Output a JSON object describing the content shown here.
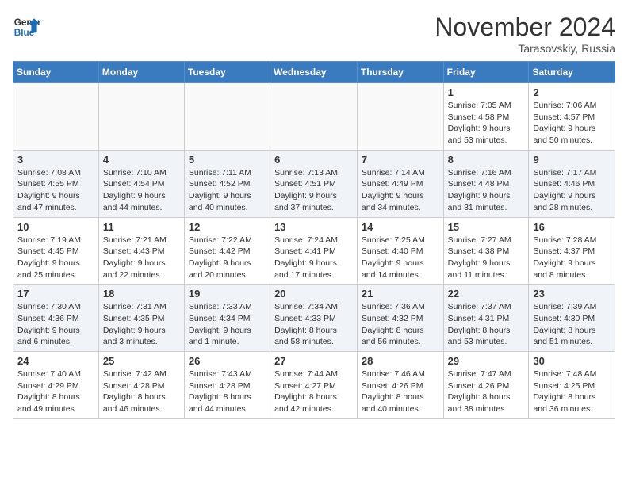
{
  "header": {
    "logo_line1": "General",
    "logo_line2": "Blue",
    "month": "November 2024",
    "location": "Tarasovskiy, Russia"
  },
  "weekdays": [
    "Sunday",
    "Monday",
    "Tuesday",
    "Wednesday",
    "Thursday",
    "Friday",
    "Saturday"
  ],
  "weeks": [
    [
      {
        "day": "",
        "info": ""
      },
      {
        "day": "",
        "info": ""
      },
      {
        "day": "",
        "info": ""
      },
      {
        "day": "",
        "info": ""
      },
      {
        "day": "",
        "info": ""
      },
      {
        "day": "1",
        "info": "Sunrise: 7:05 AM\nSunset: 4:58 PM\nDaylight: 9 hours and 53 minutes."
      },
      {
        "day": "2",
        "info": "Sunrise: 7:06 AM\nSunset: 4:57 PM\nDaylight: 9 hours and 50 minutes."
      }
    ],
    [
      {
        "day": "3",
        "info": "Sunrise: 7:08 AM\nSunset: 4:55 PM\nDaylight: 9 hours and 47 minutes."
      },
      {
        "day": "4",
        "info": "Sunrise: 7:10 AM\nSunset: 4:54 PM\nDaylight: 9 hours and 44 minutes."
      },
      {
        "day": "5",
        "info": "Sunrise: 7:11 AM\nSunset: 4:52 PM\nDaylight: 9 hours and 40 minutes."
      },
      {
        "day": "6",
        "info": "Sunrise: 7:13 AM\nSunset: 4:51 PM\nDaylight: 9 hours and 37 minutes."
      },
      {
        "day": "7",
        "info": "Sunrise: 7:14 AM\nSunset: 4:49 PM\nDaylight: 9 hours and 34 minutes."
      },
      {
        "day": "8",
        "info": "Sunrise: 7:16 AM\nSunset: 4:48 PM\nDaylight: 9 hours and 31 minutes."
      },
      {
        "day": "9",
        "info": "Sunrise: 7:17 AM\nSunset: 4:46 PM\nDaylight: 9 hours and 28 minutes."
      }
    ],
    [
      {
        "day": "10",
        "info": "Sunrise: 7:19 AM\nSunset: 4:45 PM\nDaylight: 9 hours and 25 minutes."
      },
      {
        "day": "11",
        "info": "Sunrise: 7:21 AM\nSunset: 4:43 PM\nDaylight: 9 hours and 22 minutes."
      },
      {
        "day": "12",
        "info": "Sunrise: 7:22 AM\nSunset: 4:42 PM\nDaylight: 9 hours and 20 minutes."
      },
      {
        "day": "13",
        "info": "Sunrise: 7:24 AM\nSunset: 4:41 PM\nDaylight: 9 hours and 17 minutes."
      },
      {
        "day": "14",
        "info": "Sunrise: 7:25 AM\nSunset: 4:40 PM\nDaylight: 9 hours and 14 minutes."
      },
      {
        "day": "15",
        "info": "Sunrise: 7:27 AM\nSunset: 4:38 PM\nDaylight: 9 hours and 11 minutes."
      },
      {
        "day": "16",
        "info": "Sunrise: 7:28 AM\nSunset: 4:37 PM\nDaylight: 9 hours and 8 minutes."
      }
    ],
    [
      {
        "day": "17",
        "info": "Sunrise: 7:30 AM\nSunset: 4:36 PM\nDaylight: 9 hours and 6 minutes."
      },
      {
        "day": "18",
        "info": "Sunrise: 7:31 AM\nSunset: 4:35 PM\nDaylight: 9 hours and 3 minutes."
      },
      {
        "day": "19",
        "info": "Sunrise: 7:33 AM\nSunset: 4:34 PM\nDaylight: 9 hours and 1 minute."
      },
      {
        "day": "20",
        "info": "Sunrise: 7:34 AM\nSunset: 4:33 PM\nDaylight: 8 hours and 58 minutes."
      },
      {
        "day": "21",
        "info": "Sunrise: 7:36 AM\nSunset: 4:32 PM\nDaylight: 8 hours and 56 minutes."
      },
      {
        "day": "22",
        "info": "Sunrise: 7:37 AM\nSunset: 4:31 PM\nDaylight: 8 hours and 53 minutes."
      },
      {
        "day": "23",
        "info": "Sunrise: 7:39 AM\nSunset: 4:30 PM\nDaylight: 8 hours and 51 minutes."
      }
    ],
    [
      {
        "day": "24",
        "info": "Sunrise: 7:40 AM\nSunset: 4:29 PM\nDaylight: 8 hours and 49 minutes."
      },
      {
        "day": "25",
        "info": "Sunrise: 7:42 AM\nSunset: 4:28 PM\nDaylight: 8 hours and 46 minutes."
      },
      {
        "day": "26",
        "info": "Sunrise: 7:43 AM\nSunset: 4:28 PM\nDaylight: 8 hours and 44 minutes."
      },
      {
        "day": "27",
        "info": "Sunrise: 7:44 AM\nSunset: 4:27 PM\nDaylight: 8 hours and 42 minutes."
      },
      {
        "day": "28",
        "info": "Sunrise: 7:46 AM\nSunset: 4:26 PM\nDaylight: 8 hours and 40 minutes."
      },
      {
        "day": "29",
        "info": "Sunrise: 7:47 AM\nSunset: 4:26 PM\nDaylight: 8 hours and 38 minutes."
      },
      {
        "day": "30",
        "info": "Sunrise: 7:48 AM\nSunset: 4:25 PM\nDaylight: 8 hours and 36 minutes."
      }
    ]
  ]
}
